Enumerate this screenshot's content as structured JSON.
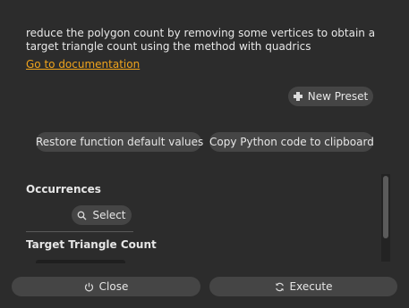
{
  "description": "reduce the polygon count by removing some vertices to obtain a target triangle count using the method with quadrics",
  "doc_link": "Go to documentation",
  "presets": {
    "new_preset_label": "New Preset",
    "icon": "plus-icon"
  },
  "actions": {
    "restore_label": "Restore function default values",
    "copy_label": "Copy Python code to clipboard"
  },
  "sections": {
    "occurrences": {
      "title": "Occurrences",
      "select_label": "Select",
      "select_icon": "search-icon"
    },
    "target_triangle_count": {
      "title": "Target Triangle Count"
    }
  },
  "footer": {
    "close_label": "Close",
    "close_icon": "power-icon",
    "execute_label": "Execute",
    "execute_icon": "refresh-icon"
  },
  "colors": {
    "background": "#2c2c2c",
    "button": "#454545",
    "link": "#f0a41c",
    "text": "#e6e6e6"
  }
}
